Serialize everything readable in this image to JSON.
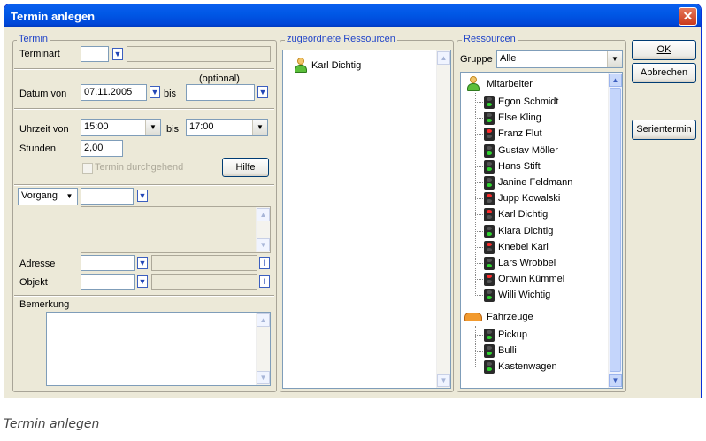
{
  "window": {
    "title": "Termin anlegen",
    "caption": "Termin anlegen"
  },
  "termin": {
    "legend": "Termin",
    "terminart_label": "Terminart",
    "terminart_value": "",
    "optional_label": "(optional)",
    "datum_label": "Datum von",
    "datum_von": "07.11.2005",
    "bis_label": "bis",
    "datum_bis": "",
    "uhrzeit_label": "Uhrzeit von",
    "uhrzeit_von": "15:00",
    "uhrzeit_bis": "17:00",
    "stunden_label": "Stunden",
    "stunden_value": "2,00",
    "durchgehend_label": "Termin durchgehend",
    "hilfe_label": "Hilfe",
    "vorgang_label": "Vorgang",
    "vorgang_value": "",
    "adresse_label": "Adresse",
    "objekt_label": "Objekt",
    "bemerkung_label": "Bemerkung",
    "bemerkung_value": ""
  },
  "assigned": {
    "legend": "zugeordnete Ressourcen",
    "items": [
      "Karl Dichtig"
    ]
  },
  "resources": {
    "legend": "Ressourcen",
    "gruppe_label": "Gruppe",
    "gruppe_value": "Alle",
    "groups": [
      {
        "name": "Mitarbeiter",
        "icon": "person-icon",
        "items": [
          {
            "name": "Egon Schmidt",
            "status": "green"
          },
          {
            "name": "Else Kling",
            "status": "green"
          },
          {
            "name": "Franz Flut",
            "status": "red"
          },
          {
            "name": "Gustav Möller",
            "status": "green"
          },
          {
            "name": "Hans Stift",
            "status": "green"
          },
          {
            "name": "Janine Feldmann",
            "status": "green"
          },
          {
            "name": "Jupp Kowalski",
            "status": "red"
          },
          {
            "name": "Karl Dichtig",
            "status": "red"
          },
          {
            "name": "Klara Dichtig",
            "status": "green"
          },
          {
            "name": "Knebel Karl",
            "status": "red"
          },
          {
            "name": "Lars Wrobbel",
            "status": "green"
          },
          {
            "name": "Ortwin Kümmel",
            "status": "red"
          },
          {
            "name": "Willi Wichtig",
            "status": "green"
          }
        ]
      },
      {
        "name": "Fahrzeuge",
        "icon": "car-icon",
        "items": [
          {
            "name": "Pickup",
            "status": "green"
          },
          {
            "name": "Bulli",
            "status": "green"
          },
          {
            "name": "Kastenwagen",
            "status": "green"
          }
        ]
      }
    ]
  },
  "buttons": {
    "ok": "OK",
    "abbrechen": "Abbrechen",
    "serientermin": "Serientermin"
  },
  "colors": {
    "titlebar": "#0058e6",
    "legend": "#1f43c8",
    "dialog": "#ece9d8",
    "status_green": "#2fd42f",
    "status_red": "#ff2a2a"
  }
}
